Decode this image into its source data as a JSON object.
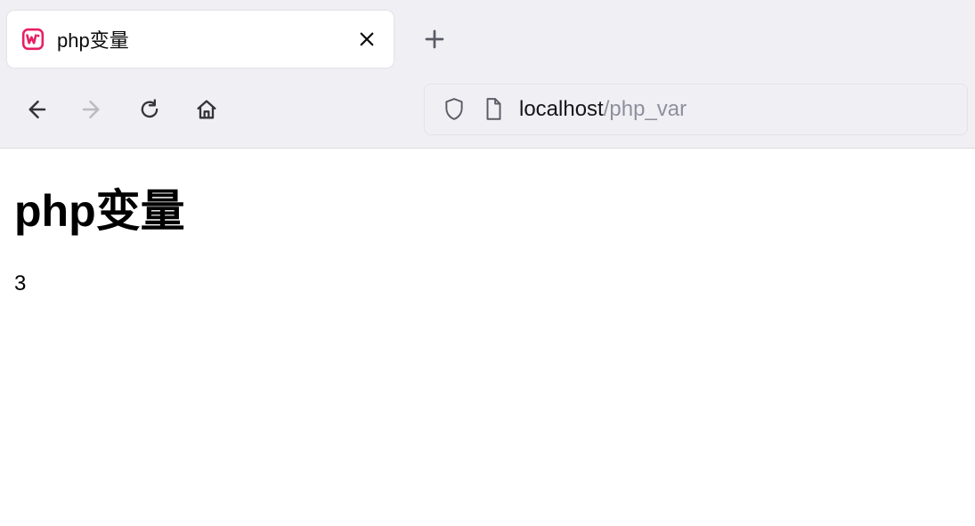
{
  "browser": {
    "tab": {
      "title": "php变量",
      "favicon_name": "wamp-icon",
      "favicon_color": "#e91e63"
    },
    "nav": {
      "back_enabled": true,
      "forward_enabled": false
    },
    "address": {
      "host": "localhost",
      "path": "/php_var"
    }
  },
  "page": {
    "heading": "php变量",
    "body_text": "3"
  }
}
